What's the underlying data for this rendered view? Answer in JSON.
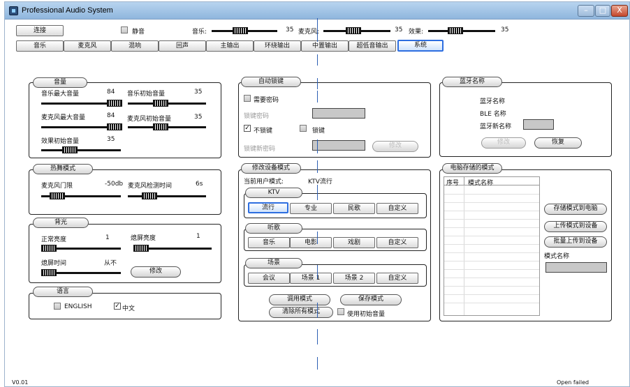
{
  "window": {
    "title": "Professional Audio System",
    "buttons": {
      "minimize": "–",
      "maximize": "□",
      "close": "X"
    }
  },
  "top": {
    "connect": "连接",
    "mute": "静音",
    "music_label": "音乐:",
    "music_value": "35",
    "mic_label": "麦克风:",
    "mic_value": "35",
    "effect_label": "效果:",
    "effect_value": "35"
  },
  "tabs": [
    {
      "label": "音乐"
    },
    {
      "label": "麦克风"
    },
    {
      "label": "混响"
    },
    {
      "label": "回声"
    },
    {
      "label": "主输出"
    },
    {
      "label": "环绕输出"
    },
    {
      "label": "中置输出"
    },
    {
      "label": "超低音输出"
    },
    {
      "label": "系统"
    }
  ],
  "volume": {
    "title": "音量",
    "music_max_label": "音乐最大音量",
    "music_max_value": "84",
    "music_init_label": "音乐初始音量",
    "music_init_value": "35",
    "mic_max_label": "麦克风最大音量",
    "mic_max_value": "84",
    "mic_init_label": "麦克风初始音量",
    "mic_init_value": "35",
    "effect_init_label": "效果初始音量",
    "effect_init_value": "35"
  },
  "dance": {
    "title": "热舞模式",
    "mic_gate_label": "麦克风门限",
    "mic_gate_value": "-50db",
    "mic_detect_label": "麦克风检测时间",
    "mic_detect_value": "6s"
  },
  "backlight": {
    "title": "背光",
    "normal_label": "正常亮度",
    "normal_value": "1",
    "off_label": "熄屏亮度",
    "off_value": "1",
    "off_time_label": "熄屏时间",
    "off_time_value": "从不",
    "modify": "修改"
  },
  "language": {
    "title": "语言",
    "english": "ENGLISH",
    "chinese": "中文"
  },
  "autolock": {
    "title": "自动锁键",
    "need_password": "需要密码",
    "lock_password": "锁键密码",
    "no_lock": "不锁键",
    "lock": "锁键",
    "new_password": "锁键新密码",
    "modify": "修改"
  },
  "device_mode": {
    "title": "修改设备模式",
    "current_label": "当前用户模式:",
    "current_value": "KTV流行",
    "ktv": {
      "title": "KTV",
      "buttons": [
        "流行",
        "专业",
        "民歌",
        "自定义"
      ]
    },
    "listen": {
      "title": "听歌",
      "buttons": [
        "音乐",
        "电影",
        "戏剧",
        "自定义"
      ]
    },
    "scene": {
      "title": "场景",
      "buttons": [
        "会议",
        "场景 1",
        "场景 2",
        "自定义"
      ]
    },
    "apply": "调用模式",
    "save": "保存模式",
    "clear": "清除所有模式",
    "use_init": "使用初始音量"
  },
  "bluetooth": {
    "title": "蓝牙名称",
    "name_label": "蓝牙名称",
    "ble_label": "BLE 名称",
    "new_label": "蓝牙新名称",
    "modify": "修改",
    "restore": "恢复"
  },
  "pc_modes": {
    "title": "电脑存储的模式",
    "col_index": "序号",
    "col_name": "模式名称",
    "store_to_pc": "存储模式到电脑",
    "upload": "上传模式到设备",
    "batch_upload": "批量上传到设备",
    "mode_name_label": "模式名称"
  },
  "status": {
    "version": "V0.01",
    "connection": "Open failed"
  }
}
